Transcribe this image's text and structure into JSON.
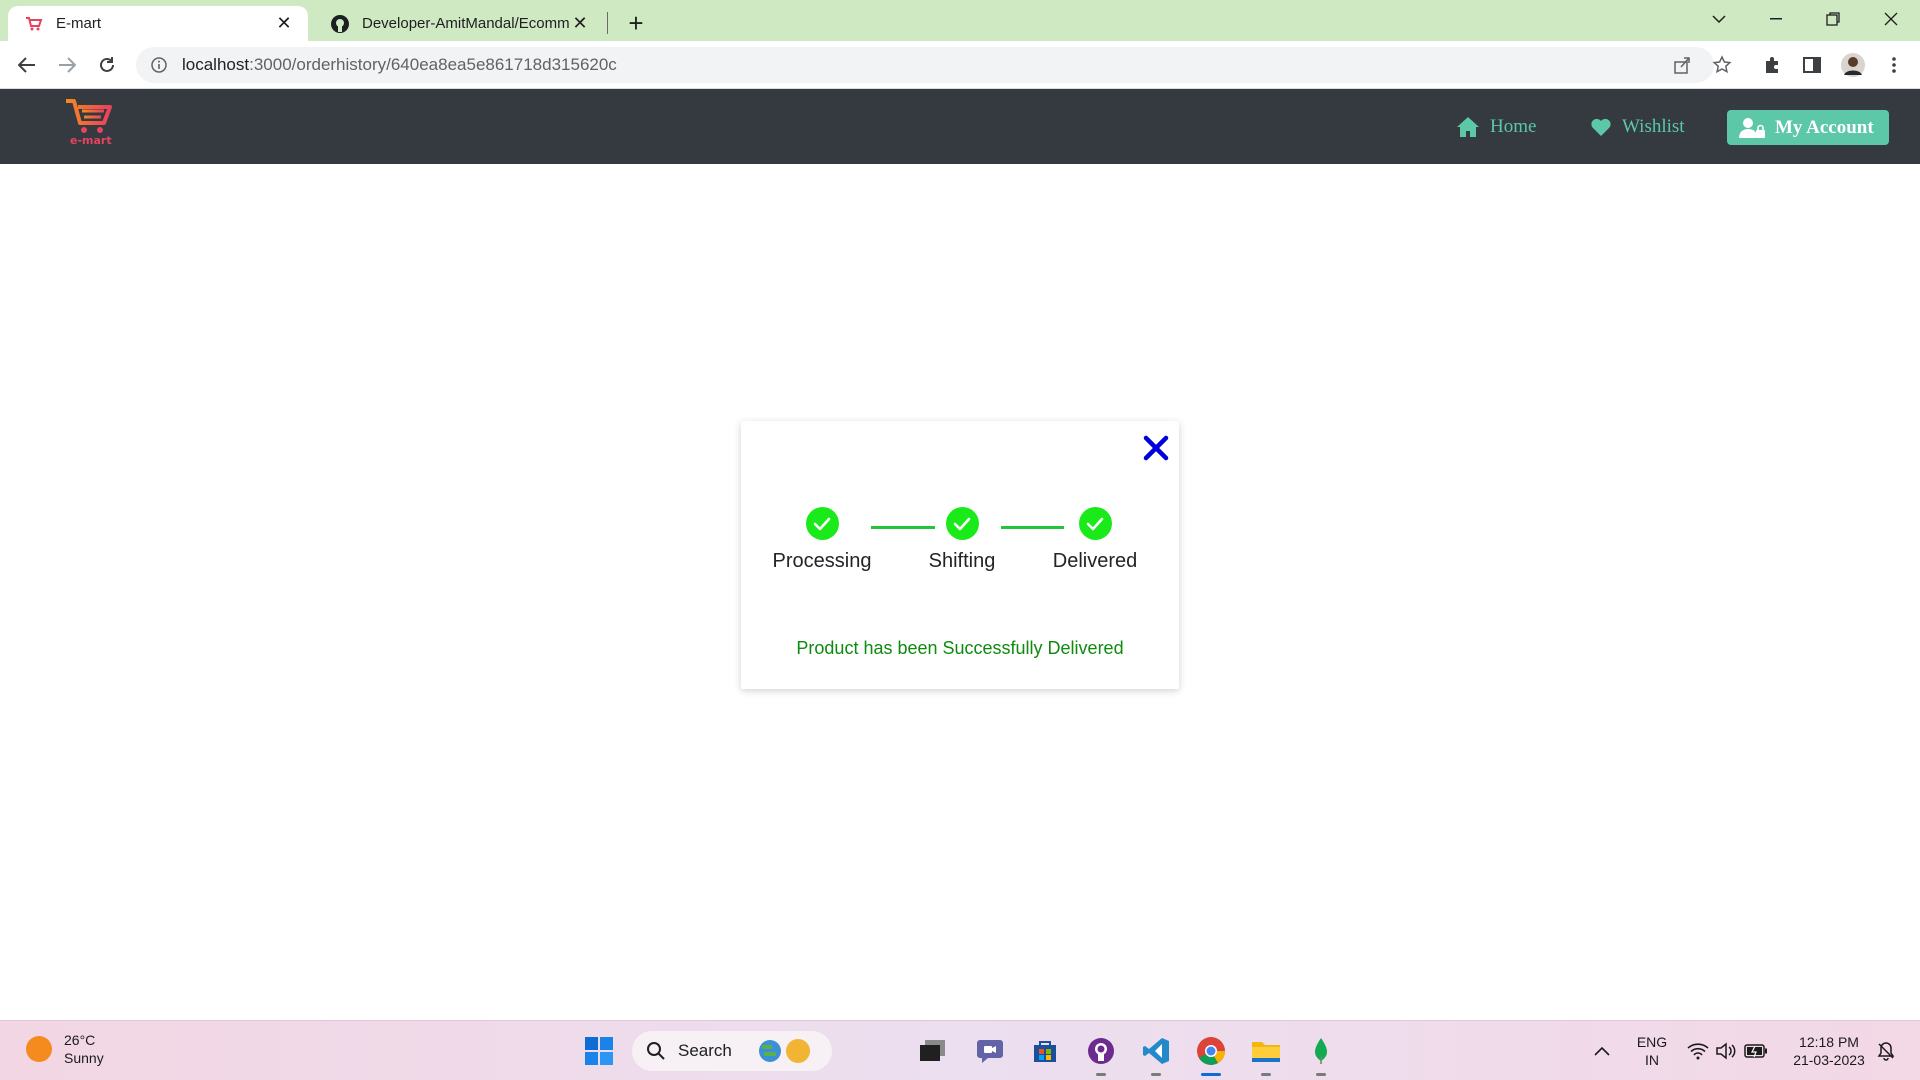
{
  "browser": {
    "tabs": [
      {
        "title": "E-mart",
        "active": true
      },
      {
        "title": "Developer-AmitMandal/Ecomme",
        "active": false
      }
    ],
    "url_host": "localhost",
    "url_rest": ":3000/orderhistory/640ea8ea5e861718d315620c"
  },
  "site": {
    "logo_text": "e-mart",
    "nav": {
      "home": "Home",
      "wishlist": "Wishlist",
      "account": "My Account"
    },
    "colors": {
      "navbar": "#343a40",
      "accent": "#5cc8a8",
      "logo": "#e7425e"
    }
  },
  "tracker": {
    "steps": [
      {
        "label": "Processing",
        "done": true
      },
      {
        "label": "Shifting",
        "done": true
      },
      {
        "label": "Delivered",
        "done": true
      }
    ],
    "message": "Product has been Successfully Delivered",
    "colors": {
      "check": "#1aea1a",
      "message": "#0e8a0e",
      "close": "#0000dd"
    }
  },
  "taskbar": {
    "weather_temp": "26°C",
    "weather_desc": "Sunny",
    "search_label": "Search",
    "lang_top": "ENG",
    "lang_bottom": "IN",
    "time": "12:18 PM",
    "date": "21-03-2023"
  }
}
